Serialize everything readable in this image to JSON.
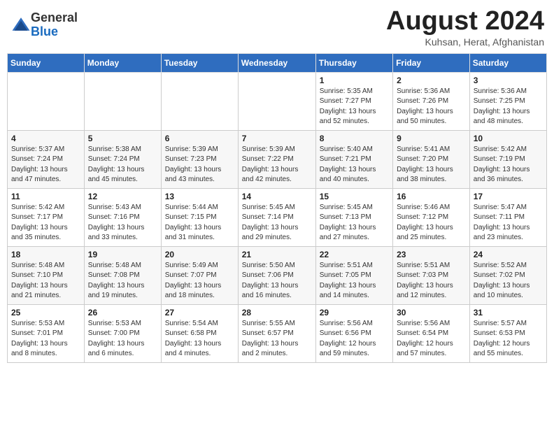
{
  "header": {
    "logo_general": "General",
    "logo_blue": "Blue",
    "month_title": "August 2024",
    "location": "Kuhsan, Herat, Afghanistan"
  },
  "weekdays": [
    "Sunday",
    "Monday",
    "Tuesday",
    "Wednesday",
    "Thursday",
    "Friday",
    "Saturday"
  ],
  "weeks": [
    [
      {
        "day": "",
        "info": ""
      },
      {
        "day": "",
        "info": ""
      },
      {
        "day": "",
        "info": ""
      },
      {
        "day": "",
        "info": ""
      },
      {
        "day": "1",
        "info": "Sunrise: 5:35 AM\nSunset: 7:27 PM\nDaylight: 13 hours\nand 52 minutes."
      },
      {
        "day": "2",
        "info": "Sunrise: 5:36 AM\nSunset: 7:26 PM\nDaylight: 13 hours\nand 50 minutes."
      },
      {
        "day": "3",
        "info": "Sunrise: 5:36 AM\nSunset: 7:25 PM\nDaylight: 13 hours\nand 48 minutes."
      }
    ],
    [
      {
        "day": "4",
        "info": "Sunrise: 5:37 AM\nSunset: 7:24 PM\nDaylight: 13 hours\nand 47 minutes."
      },
      {
        "day": "5",
        "info": "Sunrise: 5:38 AM\nSunset: 7:24 PM\nDaylight: 13 hours\nand 45 minutes."
      },
      {
        "day": "6",
        "info": "Sunrise: 5:39 AM\nSunset: 7:23 PM\nDaylight: 13 hours\nand 43 minutes."
      },
      {
        "day": "7",
        "info": "Sunrise: 5:39 AM\nSunset: 7:22 PM\nDaylight: 13 hours\nand 42 minutes."
      },
      {
        "day": "8",
        "info": "Sunrise: 5:40 AM\nSunset: 7:21 PM\nDaylight: 13 hours\nand 40 minutes."
      },
      {
        "day": "9",
        "info": "Sunrise: 5:41 AM\nSunset: 7:20 PM\nDaylight: 13 hours\nand 38 minutes."
      },
      {
        "day": "10",
        "info": "Sunrise: 5:42 AM\nSunset: 7:19 PM\nDaylight: 13 hours\nand 36 minutes."
      }
    ],
    [
      {
        "day": "11",
        "info": "Sunrise: 5:42 AM\nSunset: 7:17 PM\nDaylight: 13 hours\nand 35 minutes."
      },
      {
        "day": "12",
        "info": "Sunrise: 5:43 AM\nSunset: 7:16 PM\nDaylight: 13 hours\nand 33 minutes."
      },
      {
        "day": "13",
        "info": "Sunrise: 5:44 AM\nSunset: 7:15 PM\nDaylight: 13 hours\nand 31 minutes."
      },
      {
        "day": "14",
        "info": "Sunrise: 5:45 AM\nSunset: 7:14 PM\nDaylight: 13 hours\nand 29 minutes."
      },
      {
        "day": "15",
        "info": "Sunrise: 5:45 AM\nSunset: 7:13 PM\nDaylight: 13 hours\nand 27 minutes."
      },
      {
        "day": "16",
        "info": "Sunrise: 5:46 AM\nSunset: 7:12 PM\nDaylight: 13 hours\nand 25 minutes."
      },
      {
        "day": "17",
        "info": "Sunrise: 5:47 AM\nSunset: 7:11 PM\nDaylight: 13 hours\nand 23 minutes."
      }
    ],
    [
      {
        "day": "18",
        "info": "Sunrise: 5:48 AM\nSunset: 7:10 PM\nDaylight: 13 hours\nand 21 minutes."
      },
      {
        "day": "19",
        "info": "Sunrise: 5:48 AM\nSunset: 7:08 PM\nDaylight: 13 hours\nand 19 minutes."
      },
      {
        "day": "20",
        "info": "Sunrise: 5:49 AM\nSunset: 7:07 PM\nDaylight: 13 hours\nand 18 minutes."
      },
      {
        "day": "21",
        "info": "Sunrise: 5:50 AM\nSunset: 7:06 PM\nDaylight: 13 hours\nand 16 minutes."
      },
      {
        "day": "22",
        "info": "Sunrise: 5:51 AM\nSunset: 7:05 PM\nDaylight: 13 hours\nand 14 minutes."
      },
      {
        "day": "23",
        "info": "Sunrise: 5:51 AM\nSunset: 7:03 PM\nDaylight: 13 hours\nand 12 minutes."
      },
      {
        "day": "24",
        "info": "Sunrise: 5:52 AM\nSunset: 7:02 PM\nDaylight: 13 hours\nand 10 minutes."
      }
    ],
    [
      {
        "day": "25",
        "info": "Sunrise: 5:53 AM\nSunset: 7:01 PM\nDaylight: 13 hours\nand 8 minutes."
      },
      {
        "day": "26",
        "info": "Sunrise: 5:53 AM\nSunset: 7:00 PM\nDaylight: 13 hours\nand 6 minutes."
      },
      {
        "day": "27",
        "info": "Sunrise: 5:54 AM\nSunset: 6:58 PM\nDaylight: 13 hours\nand 4 minutes."
      },
      {
        "day": "28",
        "info": "Sunrise: 5:55 AM\nSunset: 6:57 PM\nDaylight: 13 hours\nand 2 minutes."
      },
      {
        "day": "29",
        "info": "Sunrise: 5:56 AM\nSunset: 6:56 PM\nDaylight: 12 hours\nand 59 minutes."
      },
      {
        "day": "30",
        "info": "Sunrise: 5:56 AM\nSunset: 6:54 PM\nDaylight: 12 hours\nand 57 minutes."
      },
      {
        "day": "31",
        "info": "Sunrise: 5:57 AM\nSunset: 6:53 PM\nDaylight: 12 hours\nand 55 minutes."
      }
    ]
  ]
}
